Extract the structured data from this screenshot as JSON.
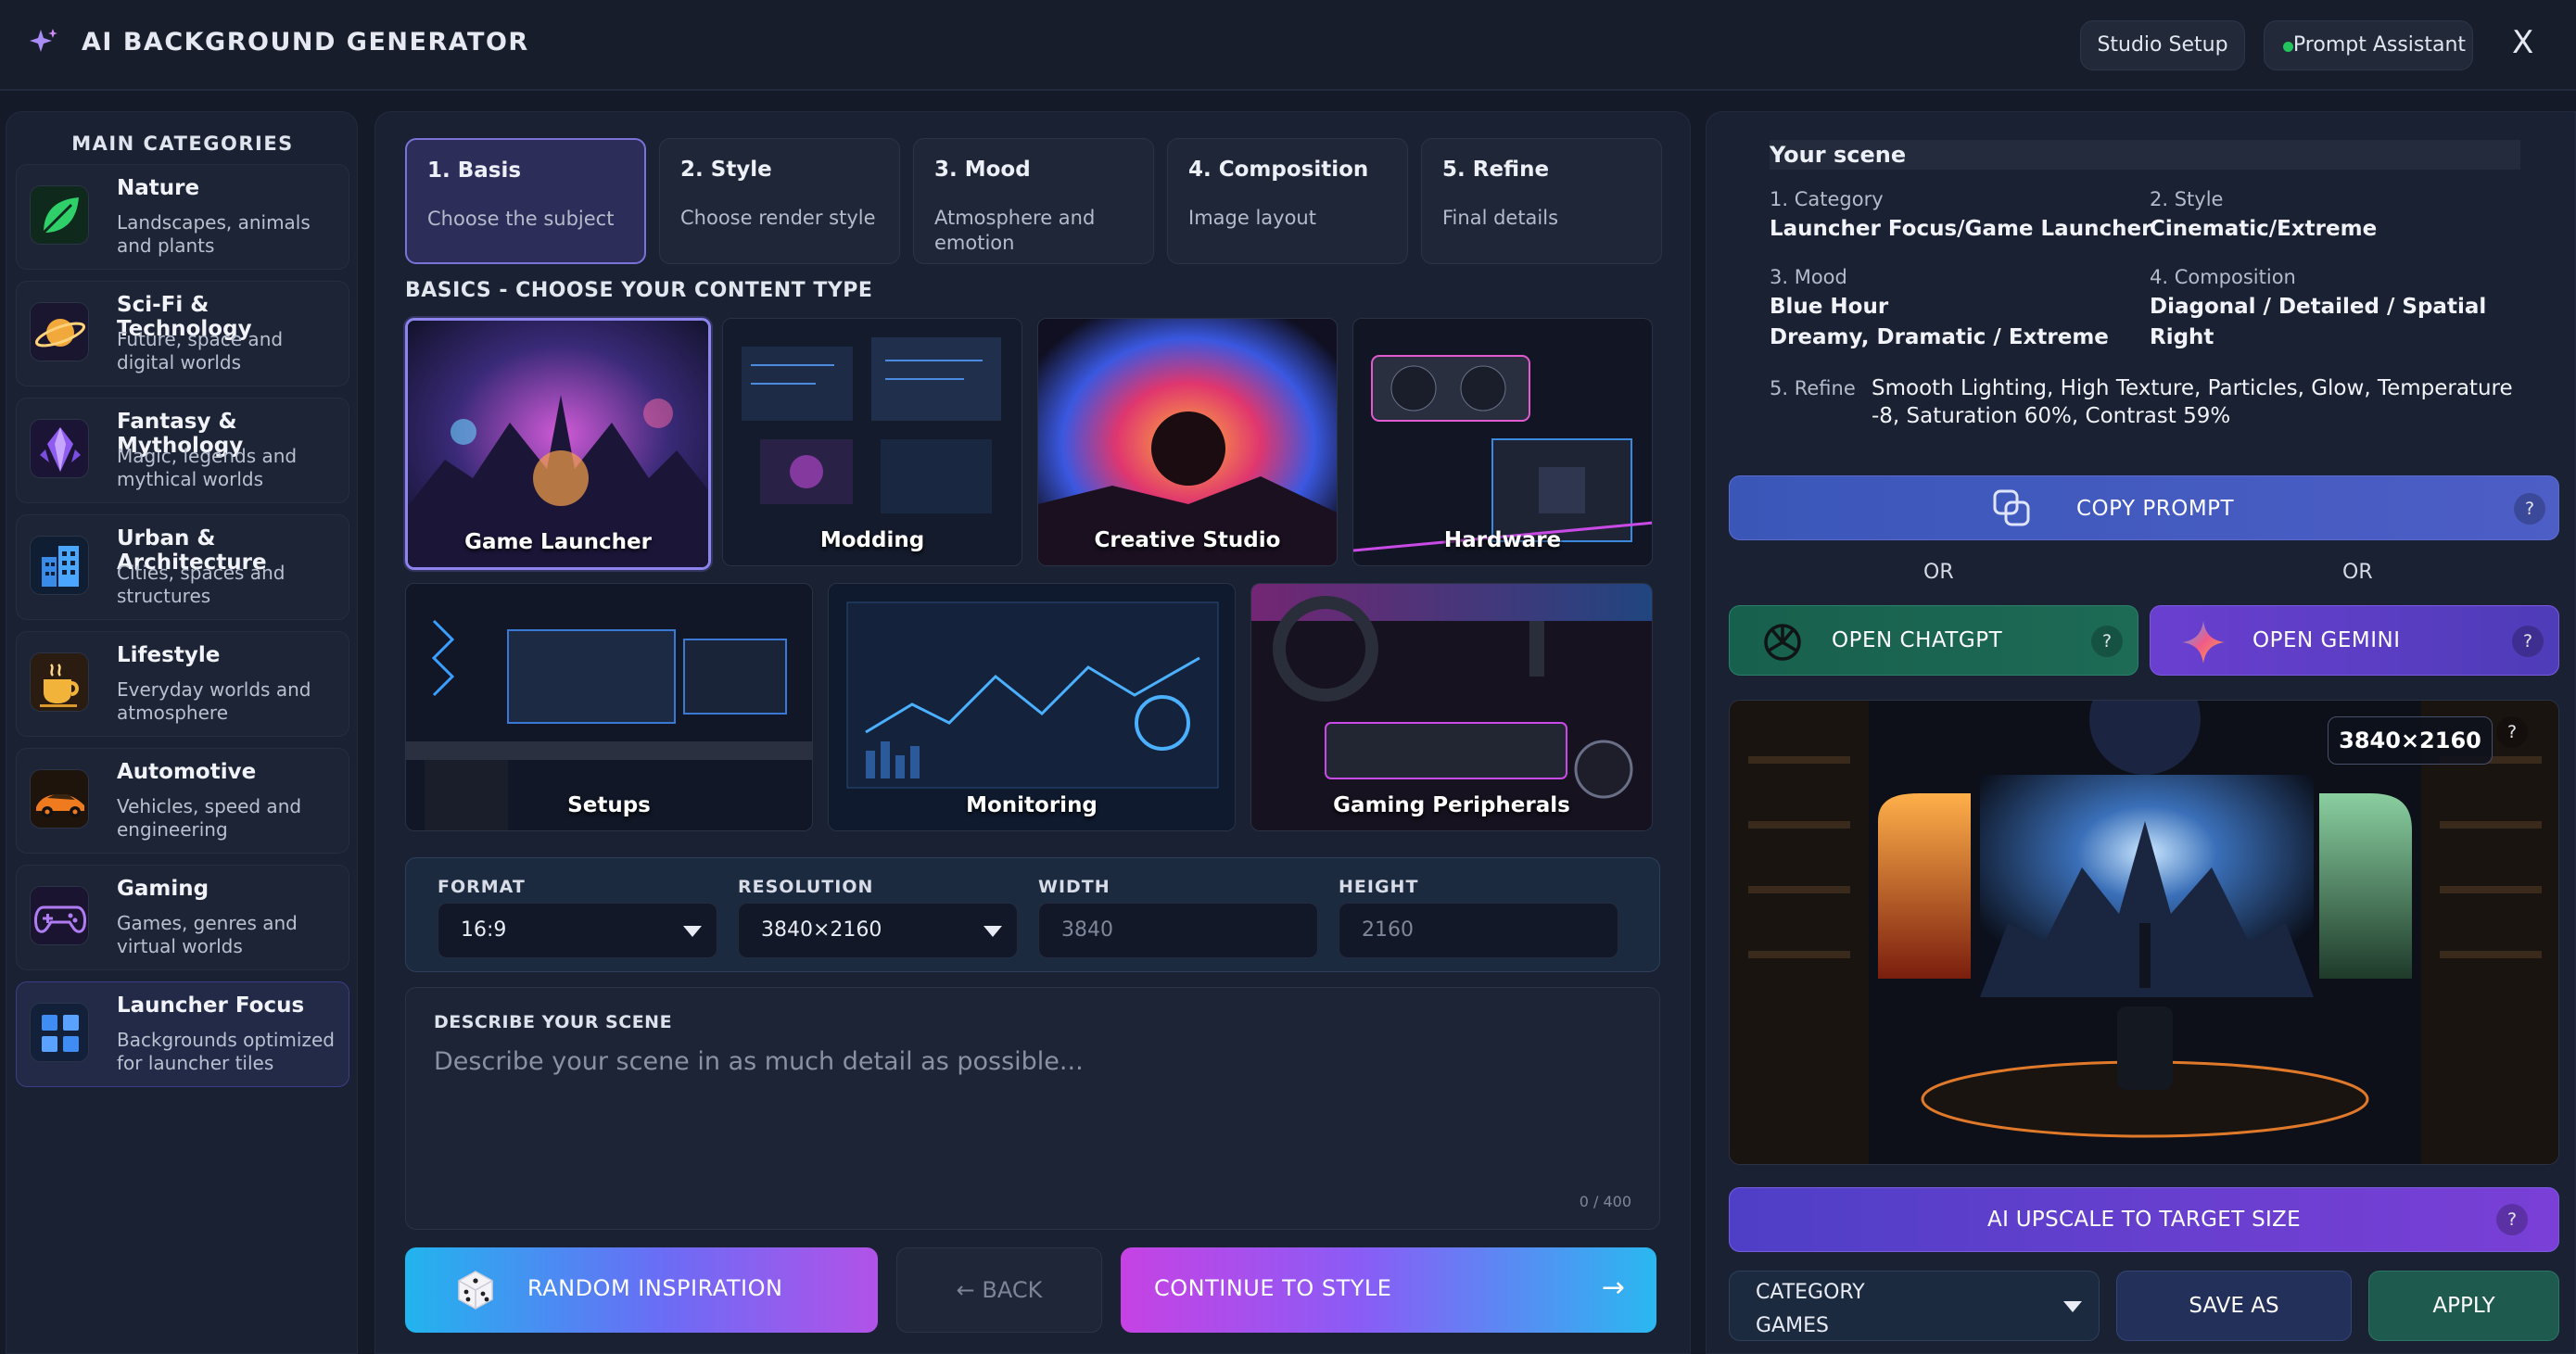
{
  "header": {
    "title": "AI BACKGROUND GENERATOR",
    "studio_setup": "Studio Setup",
    "prompt_assistant": "Prompt Assistant",
    "close": "X"
  },
  "sidebar": {
    "title": "MAIN CATEGORIES",
    "items": [
      {
        "title": "Nature",
        "sub": "Landscapes, animals and plants",
        "icon": "leaf-icon"
      },
      {
        "title": "Sci-Fi & Technology",
        "sub": "Future, space and digital worlds",
        "icon": "planet-icon"
      },
      {
        "title": "Fantasy & Mythology",
        "sub": "Magic, legends and mythical worlds",
        "icon": "crystal-icon"
      },
      {
        "title": "Urban & Architecture",
        "sub": "Cities, spaces and structures",
        "icon": "building-icon"
      },
      {
        "title": "Lifestyle",
        "sub": "Everyday worlds and atmosphere",
        "icon": "coffee-icon"
      },
      {
        "title": "Automotive",
        "sub": "Vehicles, speed and engineering",
        "icon": "car-icon"
      },
      {
        "title": "Gaming",
        "sub": "Games, genres and virtual worlds",
        "icon": "gamepad-icon"
      },
      {
        "title": "Launcher Focus",
        "sub": "Backgrounds optimized for launcher tiles",
        "icon": "grid-icon"
      }
    ],
    "active_index": 7
  },
  "steps": [
    {
      "title": "1. Basis",
      "sub": "Choose the subject"
    },
    {
      "title": "2. Style",
      "sub": "Choose render style"
    },
    {
      "title": "3. Mood",
      "sub": "Atmosphere and emotion"
    },
    {
      "title": "4. Composition",
      "sub": "Image layout"
    },
    {
      "title": "5. Refine",
      "sub": "Final details"
    }
  ],
  "basics": {
    "heading": "BASICS - CHOOSE YOUR CONTENT TYPE",
    "tiles": [
      "Game Launcher",
      "Modding",
      "Creative Studio",
      "Hardware",
      "Setups",
      "Monitoring",
      "Gaming Peripherals"
    ],
    "selected": "Game Launcher"
  },
  "format": {
    "format_label": "FORMAT",
    "format_value": "16:9",
    "resolution_label": "RESOLUTION",
    "resolution_value": "3840×2160",
    "width_label": "WIDTH",
    "width_value": "3840",
    "height_label": "HEIGHT",
    "height_value": "2160"
  },
  "describe": {
    "label": "DESCRIBE YOUR SCENE",
    "placeholder": "Describe your scene in as much detail as possible...",
    "count": "0 / 400"
  },
  "actions": {
    "random": "RANDOM INSPIRATION",
    "back": "← BACK",
    "continue": "CONTINUE TO STYLE",
    "continue_arrow": "→"
  },
  "scene": {
    "title": "Your scene",
    "category_label": "1. Category",
    "category_value": "Launcher Focus/Game Launcher",
    "style_label": "2. Style",
    "style_value": "Cinematic/Extreme",
    "mood_label": "3. Mood",
    "mood_value_1": "Blue Hour",
    "mood_value_2": "Dreamy, Dramatic / Extreme",
    "composition_label": "4. Composition",
    "composition_value_1": "Diagonal / Detailed / Spatial",
    "composition_value_2": "Right",
    "refine_label": "5. Refine",
    "refine_value_1": "Smooth Lighting, High Texture, Particles, Glow, Temperature",
    "refine_value_2": "-8, Saturation 60%, Contrast 59%"
  },
  "right": {
    "copy_prompt": "COPY PROMPT",
    "or": "OR",
    "open_chatgpt": "OPEN CHATGPT",
    "open_gemini": "OPEN GEMINI",
    "help": "?",
    "preview_resolution": "3840×2160",
    "upscale": "AI UPSCALE TO TARGET SIZE",
    "category_select_label": "CATEGORY",
    "category_select_value": "GAMES",
    "save_as": "SAVE AS",
    "apply": "APPLY"
  },
  "colors": {
    "background": "#141a28",
    "panel": "#1a2132",
    "accent_purple": "#8d84ee",
    "status_green": "#22c55e"
  }
}
